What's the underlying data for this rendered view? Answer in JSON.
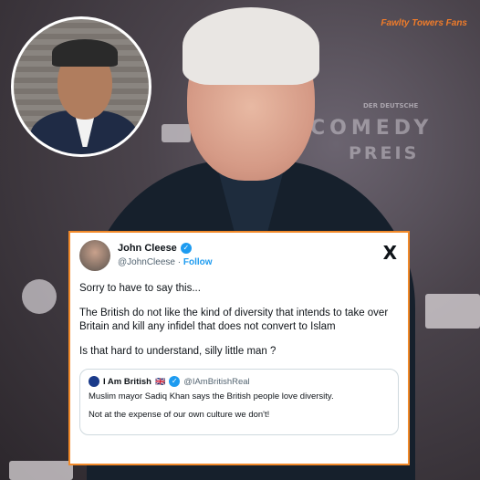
{
  "watermark": "Fawlty Towers Fans",
  "backdrop": {
    "small_caption": "DER DEUTSCHE",
    "comedy_word": "COMEDY",
    "preis_word": "PREIS"
  },
  "tweet": {
    "author_name": "John Cleese",
    "author_handle": "@JohnCleese",
    "separator": "·",
    "follow_label": "Follow",
    "verified_icon": "✓",
    "platform_icon": "X",
    "paragraphs": [
      "Sorry to have to say this...",
      "The British do not like the kind of diversity that intends to take over Britain and kill any infidel that does not convert to Islam",
      "Is that hard to understand, silly little man ?"
    ],
    "quoted": {
      "name": "I Am British",
      "flag": "🇬🇧",
      "verified_icon": "✓",
      "handle": "@IAmBritishReal",
      "paragraphs": [
        "Muslim mayor Sadiq Khan says the British people love diversity.",
        "Not at the expense of our own culture we don't!"
      ]
    }
  }
}
